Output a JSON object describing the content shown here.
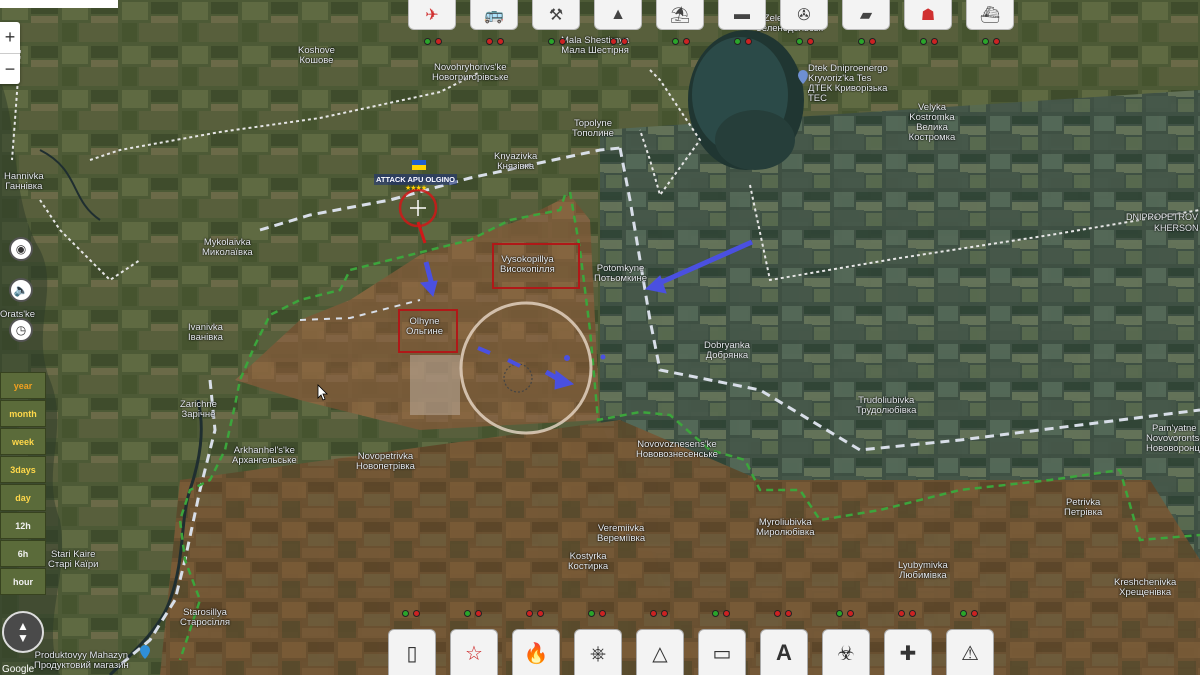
{
  "map": {
    "places": [
      {
        "id": "koshove",
        "latin": "Koshove",
        "cyr": "Кошове"
      },
      {
        "id": "novohryhorivske",
        "latin": "Novohryhorivs'ke",
        "cyr": "Новогригорівське"
      },
      {
        "id": "mala-shestirnia",
        "latin": "Mala Shestirnya",
        "cyr": "Мала Шестірня"
      },
      {
        "id": "zelenodolsk",
        "latin": "Zelenodolsk",
        "cyr": "Зеленодольськ"
      },
      {
        "id": "dtek",
        "latin": "Dtek Dniproenergo Kryvoriz'ka Tes",
        "cyr": "ДТЕК Криворізька ТЕС"
      },
      {
        "id": "velyka-kostromka",
        "latin": "Velyka Kostromka",
        "cyr": "Велика Костромка"
      },
      {
        "id": "topolyne",
        "latin": "Topolyne",
        "cyr": "Тополине"
      },
      {
        "id": "knyazivka",
        "latin": "Knyazivka",
        "cyr": "Князівка"
      },
      {
        "id": "hannivka",
        "latin": "Hannivka",
        "cyr": "Ганнівка"
      },
      {
        "id": "mykolaivka",
        "latin": "Mykolaivka",
        "cyr": "Миколаївка"
      },
      {
        "id": "vysokopillya",
        "latin": "Vysokopillya",
        "cyr": "Високопілля"
      },
      {
        "id": "potomkyne",
        "latin": "Potomkyne",
        "cyr": "Потьомкине"
      },
      {
        "id": "ivanivka",
        "latin": "Ivanivka",
        "cyr": "Іванівка"
      },
      {
        "id": "olhyne",
        "latin": "Olhyne",
        "cyr": "Ольгине"
      },
      {
        "id": "dobryanka",
        "latin": "Dobryanka",
        "cyr": "Добрянка"
      },
      {
        "id": "trudoliubivka",
        "latin": "Trudoliubivka",
        "cyr": "Трудолюбівка"
      },
      {
        "id": "zarichne",
        "latin": "Zarichne",
        "cyr": "Зарічне"
      },
      {
        "id": "arkhanhelske",
        "latin": "Arkhanhel's'ke",
        "cyr": "Архангельське"
      },
      {
        "id": "novopetrivka",
        "latin": "Novopetrivka",
        "cyr": "Новопетрівка"
      },
      {
        "id": "novovoznesenske",
        "latin": "Novovoznesens'ke",
        "cyr": "Нововознесенське"
      },
      {
        "id": "pamiatne",
        "latin": "Pam'yatne",
        "cyr": "Пам'ятне"
      },
      {
        "id": "novovorontsovka",
        "latin": "Novovorontsovka",
        "cyr": "Нововоронцовка"
      },
      {
        "id": "petrivka",
        "latin": "Petrivka",
        "cyr": "Петрівка"
      },
      {
        "id": "myroliubivka",
        "latin": "Myroliubivka",
        "cyr": "Миролюбівка"
      },
      {
        "id": "veremiivka",
        "latin": "Veremiivka",
        "cyr": "Веремiївка"
      },
      {
        "id": "lyubymivka",
        "latin": "Lyubymivka",
        "cyr": "Любимівка"
      },
      {
        "id": "kostyrka",
        "latin": "Kostyrka",
        "cyr": "Костирка"
      },
      {
        "id": "kreshchenivka",
        "latin": "Kreshchenivka",
        "cyr": "Хрещенівка"
      },
      {
        "id": "starosillya",
        "latin": "Starosillya",
        "cyr": "Старосілля"
      },
      {
        "id": "stari-kaire",
        "latin": "Stari Kaire",
        "cyr": "Старі Каїри"
      },
      {
        "id": "orats-ke",
        "latin": "Orats'ke",
        "cyr": ""
      },
      {
        "id": "produktovyi",
        "latin": "Produktovyy Mahazyn",
        "cyr": "Продуктовий магазин"
      }
    ],
    "regions": {
      "dnipropetrovsk": "DNIPROPETROV",
      "kherson": "KHERSON"
    },
    "attack_label": "ATTACK APU OLGINO",
    "attack_stars": "★★★★",
    "flag_colors": {
      "blue": "#1f5fd0",
      "yellow": "#ffd500"
    },
    "frontline_color": "#3ca53c",
    "arrow_color": "#4a50e0",
    "marker_color": "#d01818",
    "google": "Google"
  },
  "top_toolbar": [
    {
      "name": "aircraft-tool",
      "icon": "✈"
    },
    {
      "name": "vehicle-tool",
      "icon": "🚌"
    },
    {
      "name": "artillery-tool",
      "icon": "⚒"
    },
    {
      "name": "air-defense-tool",
      "icon": "▲"
    },
    {
      "name": "airborne-tool",
      "icon": "⛱"
    },
    {
      "name": "armor-tool",
      "icon": "▬"
    },
    {
      "name": "helicopter-tool",
      "icon": "✇"
    },
    {
      "name": "tank-tool",
      "icon": "▰"
    },
    {
      "name": "infantry-tool",
      "icon": "☗"
    },
    {
      "name": "naval-tool",
      "icon": "⛴"
    }
  ],
  "bottom_toolbar": [
    {
      "name": "fortification-tool",
      "icon": "▯"
    },
    {
      "name": "star-tool",
      "icon": "☆"
    },
    {
      "name": "fire-tool",
      "icon": "🔥"
    },
    {
      "name": "path-tool",
      "icon": "⎈"
    },
    {
      "name": "triangle-tool",
      "icon": "△"
    },
    {
      "name": "ruler-tool",
      "icon": "▭"
    },
    {
      "name": "text-tool",
      "icon": "A"
    },
    {
      "name": "biohazard-tool",
      "icon": "☣"
    },
    {
      "name": "medical-tool",
      "icon": "✚"
    },
    {
      "name": "warning-tool",
      "icon": "⚠"
    }
  ],
  "zoom": {
    "in": "+",
    "out": "−"
  },
  "time_filters": [
    "year",
    "month",
    "week",
    "3days",
    "day",
    "12h",
    "6h",
    "hour"
  ]
}
